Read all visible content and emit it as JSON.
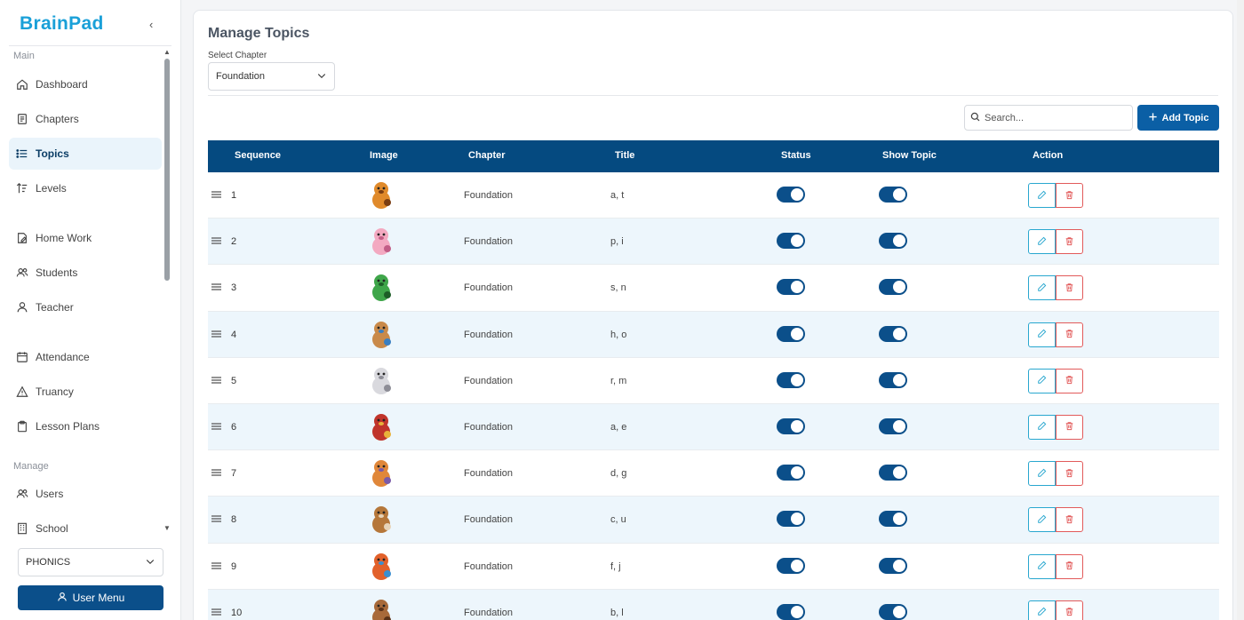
{
  "app": {
    "brand": "BrainPad"
  },
  "sidebar": {
    "sections": {
      "main": "Main",
      "manage": "Manage"
    },
    "items": [
      {
        "label": "Dashboard",
        "icon": "home-icon"
      },
      {
        "label": "Chapters",
        "icon": "book-icon"
      },
      {
        "label": "Topics",
        "icon": "list-icon",
        "active": true
      },
      {
        "label": "Levels",
        "icon": "sort-icon"
      },
      {
        "label": "Home Work",
        "icon": "file-edit-icon"
      },
      {
        "label": "Students",
        "icon": "users-icon"
      },
      {
        "label": "Teacher",
        "icon": "user-icon"
      },
      {
        "label": "Attendance",
        "icon": "calendar-icon"
      },
      {
        "label": "Truancy",
        "icon": "warning-icon"
      },
      {
        "label": "Lesson Plans",
        "icon": "clipboard-icon"
      },
      {
        "label": "Users",
        "icon": "users-icon"
      },
      {
        "label": "School",
        "icon": "building-icon"
      }
    ],
    "program_select": "PHONICS",
    "user_menu": "User Menu"
  },
  "main": {
    "title": "Manage Topics",
    "chapter_label": "Select Chapter",
    "chapter_value": "Foundation",
    "search_placeholder": "Search...",
    "add_button": "Add Topic",
    "columns": [
      "Sequence",
      "Image",
      "Chapter",
      "Title",
      "Status",
      "Show Topic",
      "Action"
    ],
    "rows": [
      {
        "seq": "1",
        "chapter": "Foundation",
        "title": "a, t",
        "status": true,
        "show": true,
        "image": "tiger-icon"
      },
      {
        "seq": "2",
        "chapter": "Foundation",
        "title": "p, i",
        "status": true,
        "show": true,
        "image": "pig-icon"
      },
      {
        "seq": "3",
        "chapter": "Foundation",
        "title": "s, n",
        "status": true,
        "show": true,
        "image": "snake-icon"
      },
      {
        "seq": "4",
        "chapter": "Foundation",
        "title": "h, o",
        "status": true,
        "show": true,
        "image": "horse-icon"
      },
      {
        "seq": "5",
        "chapter": "Foundation",
        "title": "r, m",
        "status": true,
        "show": true,
        "image": "rabbit-icon"
      },
      {
        "seq": "6",
        "chapter": "Foundation",
        "title": "a, e",
        "status": true,
        "show": true,
        "image": "ant-icon"
      },
      {
        "seq": "7",
        "chapter": "Foundation",
        "title": "d, g",
        "status": true,
        "show": true,
        "image": "dog-icon"
      },
      {
        "seq": "8",
        "chapter": "Foundation",
        "title": "c, u",
        "status": true,
        "show": true,
        "image": "mushroom-icon"
      },
      {
        "seq": "9",
        "chapter": "Foundation",
        "title": "f, j",
        "status": true,
        "show": true,
        "image": "fox-icon"
      },
      {
        "seq": "10",
        "chapter": "Foundation",
        "title": "b, l",
        "status": true,
        "show": true,
        "image": "bear-icon"
      }
    ]
  },
  "colors": {
    "primary": "#054a80",
    "accent": "#1aa0d8",
    "edit": "#29a7cf",
    "delete": "#e25a5a",
    "row_alt": "#edf6fc"
  }
}
